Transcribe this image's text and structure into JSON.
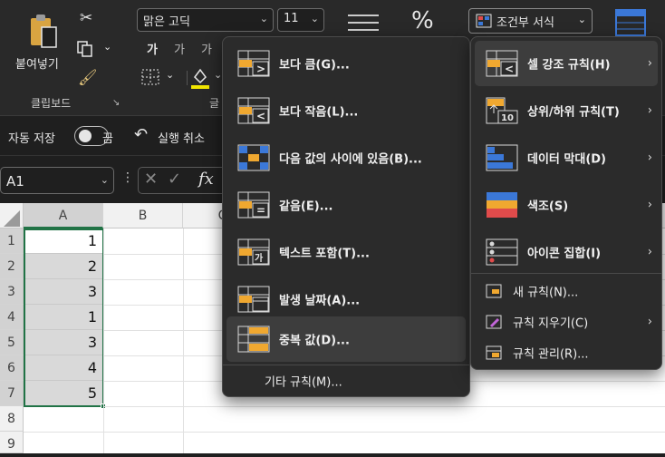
{
  "ribbon": {
    "clipboard": {
      "paste_label": "붙여넣기",
      "group_label": "클립보드"
    },
    "font": {
      "name": "맑은 고딕",
      "size": "11",
      "group_label_partial": "글"
    },
    "cond_format_label": "조건부 서식"
  },
  "toolbar2": {
    "autosave_label": "자동 저장",
    "toggle_state": "끔",
    "undo_label": "실행 취소"
  },
  "formula": {
    "name_box": "A1",
    "fx": "fx"
  },
  "sheet": {
    "columns": [
      "A",
      "B",
      "C"
    ],
    "rows": [
      "1",
      "2",
      "3",
      "4",
      "5",
      "6",
      "7",
      "8",
      "9"
    ],
    "a_values": [
      "1",
      "2",
      "3",
      "1",
      "3",
      "4",
      "5"
    ]
  },
  "submenu": {
    "items": [
      {
        "label": "보다 큼(G)...",
        "icon": "greater-than-icon"
      },
      {
        "label": "보다 작음(L)...",
        "icon": "less-than-icon"
      },
      {
        "label": "다음 값의 사이에 있음(B)...",
        "icon": "between-icon"
      },
      {
        "label": "같음(E)...",
        "icon": "equal-to-icon"
      },
      {
        "label": "텍스트 포함(T)...",
        "icon": "text-contains-icon"
      },
      {
        "label": "발생 날짜(A)...",
        "icon": "date-occurring-icon"
      },
      {
        "label": "중복 값(D)...",
        "icon": "duplicate-values-icon"
      }
    ],
    "more_rules": "기타 규칙(M)..."
  },
  "cf_menu": {
    "items": [
      {
        "label": "셀 강조 규칙(H)",
        "icon": "highlight-cells-rules-icon"
      },
      {
        "label": "상위/하위 규칙(T)",
        "icon": "top-bottom-rules-icon"
      },
      {
        "label": "데이터 막대(D)",
        "icon": "data-bars-icon"
      },
      {
        "label": "색조(S)",
        "icon": "color-scales-icon"
      },
      {
        "label": "아이콘 집합(I)",
        "icon": "icon-sets-icon"
      }
    ],
    "small_items": [
      {
        "label": "새 규칙(N)...",
        "icon": "new-rule-icon"
      },
      {
        "label": "규칙 지우기(C)",
        "icon": "clear-rules-icon"
      },
      {
        "label": "규칙 관리(R)...",
        "icon": "manage-rules-icon"
      }
    ]
  }
}
